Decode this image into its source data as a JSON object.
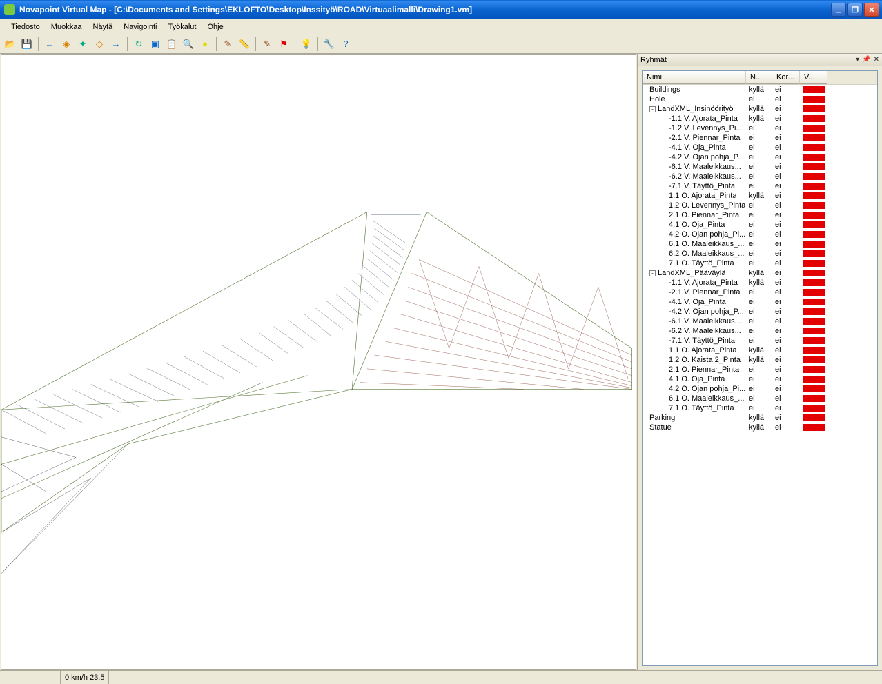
{
  "title": "Novapoint Virtual Map - [C:\\Documents and Settings\\EKLOFTO\\Desktop\\Inssityö\\ROAD\\Virtuaalimalli\\Drawing1.vm]",
  "menu": [
    "Tiedosto",
    "Muokkaa",
    "Näytä",
    "Navigointi",
    "Työkalut",
    "Ohje"
  ],
  "panel": {
    "title": "Ryhmät",
    "columns": {
      "name": "Nimi",
      "n": "N...",
      "kor": "Kor...",
      "v": "V..."
    }
  },
  "status": {
    "speed": "0 km/h  23.5"
  },
  "tree": [
    {
      "level": 0,
      "expander": "",
      "name": "Buildings",
      "n": "kyllä",
      "kor": "ei",
      "color": "#e30000"
    },
    {
      "level": 0,
      "expander": "",
      "name": "Hole",
      "n": "ei",
      "kor": "ei",
      "color": "#e30000"
    },
    {
      "level": 0,
      "expander": "-",
      "name": "LandXML_Insinöörityö",
      "n": "kyllä",
      "kor": "ei",
      "color": "#e30000"
    },
    {
      "level": 1,
      "expander": "",
      "name": "-1.1 V. Ajorata_Pinta",
      "n": "kyllä",
      "kor": "ei",
      "color": "#e30000"
    },
    {
      "level": 1,
      "expander": "",
      "name": "-1.2 V. Levennys_Pi...",
      "n": "ei",
      "kor": "ei",
      "color": "#e30000"
    },
    {
      "level": 1,
      "expander": "",
      "name": "-2.1 V. Piennar_Pinta",
      "n": "ei",
      "kor": "ei",
      "color": "#e30000"
    },
    {
      "level": 1,
      "expander": "",
      "name": "-4.1 V. Oja_Pinta",
      "n": "ei",
      "kor": "ei",
      "color": "#e30000"
    },
    {
      "level": 1,
      "expander": "",
      "name": "-4.2 V. Ojan pohja_P...",
      "n": "ei",
      "kor": "ei",
      "color": "#e30000"
    },
    {
      "level": 1,
      "expander": "",
      "name": "-6.1 V. Maaleikkaus...",
      "n": "ei",
      "kor": "ei",
      "color": "#e30000"
    },
    {
      "level": 1,
      "expander": "",
      "name": "-6.2 V. Maaleikkaus...",
      "n": "ei",
      "kor": "ei",
      "color": "#e30000"
    },
    {
      "level": 1,
      "expander": "",
      "name": "-7.1 V. Täyttö_Pinta",
      "n": "ei",
      "kor": "ei",
      "color": "#e30000"
    },
    {
      "level": 1,
      "expander": "",
      "name": "1.1 O. Ajorata_Pinta",
      "n": "kyllä",
      "kor": "ei",
      "color": "#e30000"
    },
    {
      "level": 1,
      "expander": "",
      "name": "1.2 O. Levennys_Pinta",
      "n": "ei",
      "kor": "ei",
      "color": "#e30000"
    },
    {
      "level": 1,
      "expander": "",
      "name": "2.1 O. Piennar_Pinta",
      "n": "ei",
      "kor": "ei",
      "color": "#e30000"
    },
    {
      "level": 1,
      "expander": "",
      "name": "4.1 O. Oja_Pinta",
      "n": "ei",
      "kor": "ei",
      "color": "#e30000"
    },
    {
      "level": 1,
      "expander": "",
      "name": "4.2 O. Ojan pohja_Pi...",
      "n": "ei",
      "kor": "ei",
      "color": "#e30000"
    },
    {
      "level": 1,
      "expander": "",
      "name": "6.1 O. Maaleikkaus_...",
      "n": "ei",
      "kor": "ei",
      "color": "#e30000"
    },
    {
      "level": 1,
      "expander": "",
      "name": "6.2 O. Maaleikkaus_...",
      "n": "ei",
      "kor": "ei",
      "color": "#e30000"
    },
    {
      "level": 1,
      "expander": "",
      "name": "7.1 O. Täyttö_Pinta",
      "n": "ei",
      "kor": "ei",
      "color": "#e30000"
    },
    {
      "level": 0,
      "expander": "-",
      "name": "LandXML_Pääväylä",
      "n": "kyllä",
      "kor": "ei",
      "color": "#e30000"
    },
    {
      "level": 1,
      "expander": "",
      "name": "-1.1 V. Ajorata_Pinta",
      "n": "kyllä",
      "kor": "ei",
      "color": "#e30000"
    },
    {
      "level": 1,
      "expander": "",
      "name": "-2.1 V. Piennar_Pinta",
      "n": "ei",
      "kor": "ei",
      "color": "#e30000"
    },
    {
      "level": 1,
      "expander": "",
      "name": "-4.1 V. Oja_Pinta",
      "n": "ei",
      "kor": "ei",
      "color": "#e30000"
    },
    {
      "level": 1,
      "expander": "",
      "name": "-4.2 V. Ojan pohja_P...",
      "n": "ei",
      "kor": "ei",
      "color": "#e30000"
    },
    {
      "level": 1,
      "expander": "",
      "name": "-6.1 V. Maaleikkaus...",
      "n": "ei",
      "kor": "ei",
      "color": "#e30000"
    },
    {
      "level": 1,
      "expander": "",
      "name": "-6.2 V. Maaleikkaus...",
      "n": "ei",
      "kor": "ei",
      "color": "#e30000"
    },
    {
      "level": 1,
      "expander": "",
      "name": "-7.1 V. Täyttö_Pinta",
      "n": "ei",
      "kor": "ei",
      "color": "#e30000"
    },
    {
      "level": 1,
      "expander": "",
      "name": "1.1 O. Ajorata_Pinta",
      "n": "kyllä",
      "kor": "ei",
      "color": "#e30000"
    },
    {
      "level": 1,
      "expander": "",
      "name": "1.2 O. Kaista 2_Pinta",
      "n": "kyllä",
      "kor": "ei",
      "color": "#e30000"
    },
    {
      "level": 1,
      "expander": "",
      "name": "2.1 O. Piennar_Pinta",
      "n": "ei",
      "kor": "ei",
      "color": "#e30000"
    },
    {
      "level": 1,
      "expander": "",
      "name": "4.1 O. Oja_Pinta",
      "n": "ei",
      "kor": "ei",
      "color": "#e30000"
    },
    {
      "level": 1,
      "expander": "",
      "name": "4.2 O. Ojan pohja_Pi...",
      "n": "ei",
      "kor": "ei",
      "color": "#e30000"
    },
    {
      "level": 1,
      "expander": "",
      "name": "6.1 O. Maaleikkaus_...",
      "n": "ei",
      "kor": "ei",
      "color": "#e30000"
    },
    {
      "level": 1,
      "expander": "",
      "name": "7.1 O. Täyttö_Pinta",
      "n": "ei",
      "kor": "ei",
      "color": "#e30000"
    },
    {
      "level": 0,
      "expander": "",
      "name": "Parking",
      "n": "kyllä",
      "kor": "ei",
      "color": "#e30000"
    },
    {
      "level": 0,
      "expander": "",
      "name": "Statue",
      "n": "kyllä",
      "kor": "ei",
      "color": "#e30000"
    }
  ]
}
